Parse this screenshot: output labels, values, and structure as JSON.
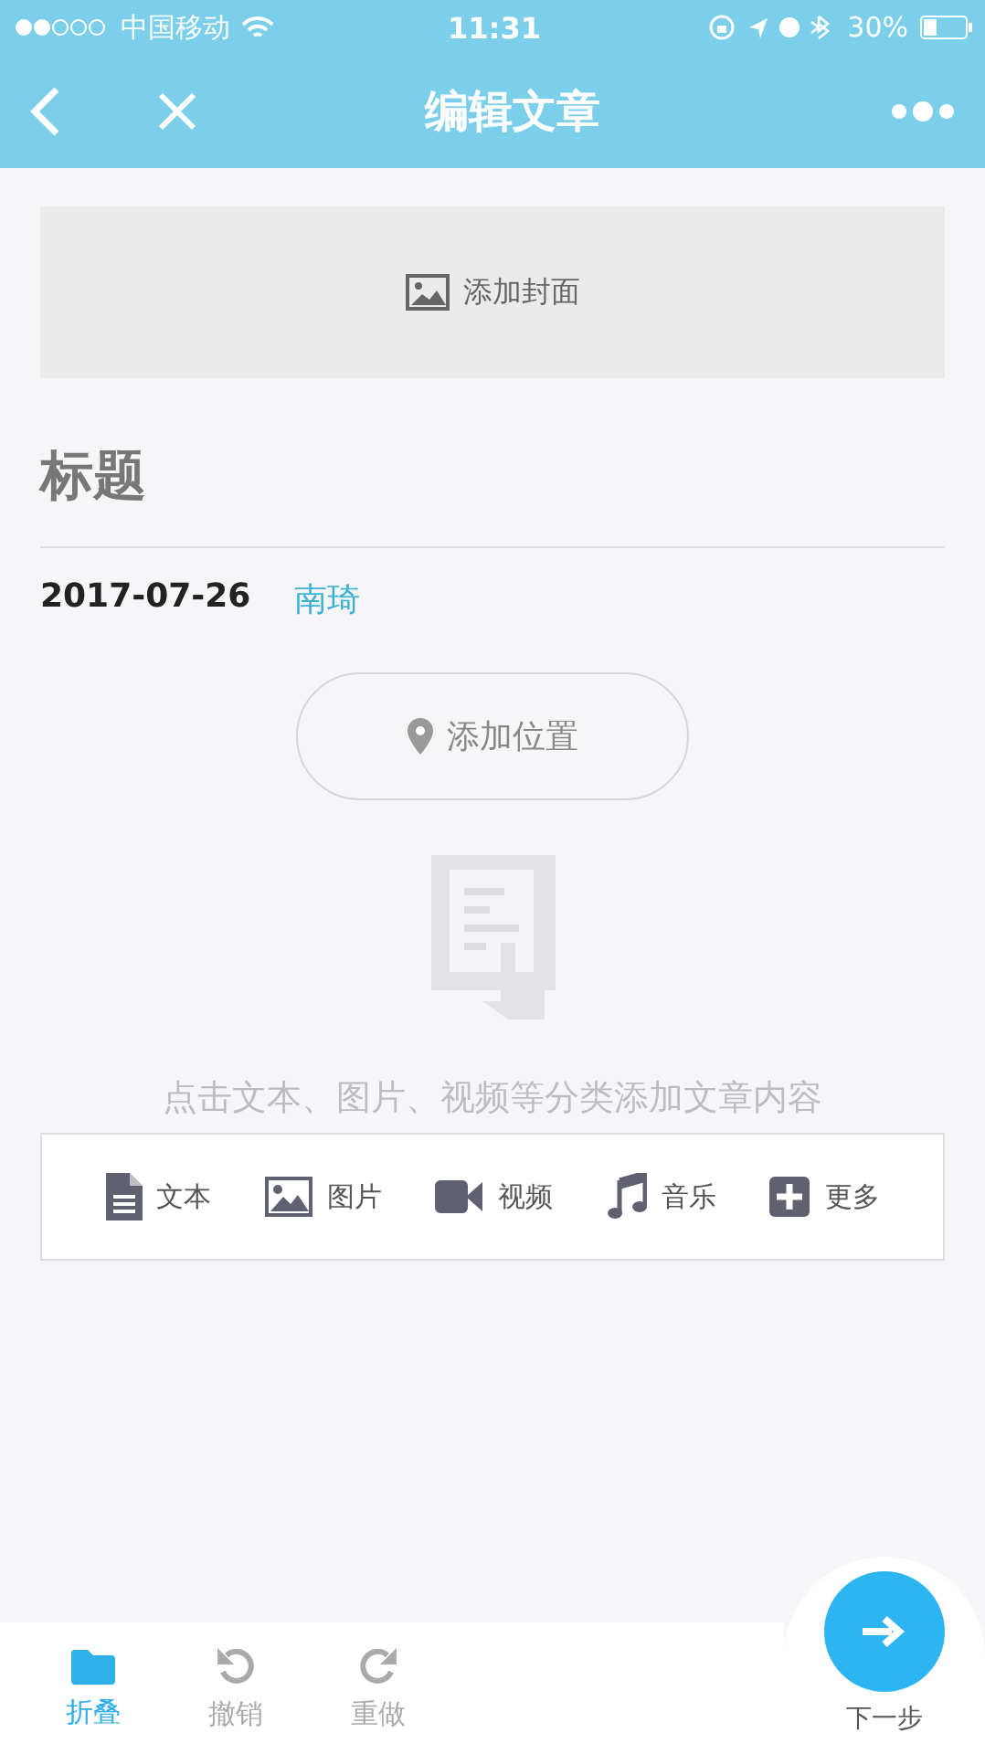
{
  "status_bar": {
    "carrier": "中国移动",
    "time": "11:31",
    "battery": "30%"
  },
  "nav": {
    "title": "编辑文章"
  },
  "cover": {
    "label": "添加封面"
  },
  "article": {
    "title_placeholder": "标题",
    "date": "2017-07-26",
    "author": "南琦"
  },
  "location": {
    "label": "添加位置"
  },
  "empty_hint": "点击文本、图片、视频等分类添加文章内容",
  "insert_tools": [
    {
      "kind": "text",
      "label": "文本"
    },
    {
      "kind": "image",
      "label": "图片"
    },
    {
      "kind": "video",
      "label": "视频"
    },
    {
      "kind": "music",
      "label": "音乐"
    },
    {
      "kind": "more",
      "label": "更多"
    }
  ],
  "bottom_actions": [
    {
      "kind": "fold",
      "label": "折叠",
      "selected": true
    },
    {
      "kind": "undo",
      "label": "撤销",
      "selected": false
    },
    {
      "kind": "redo",
      "label": "重做",
      "selected": false
    }
  ],
  "next": {
    "label": "下一步"
  }
}
